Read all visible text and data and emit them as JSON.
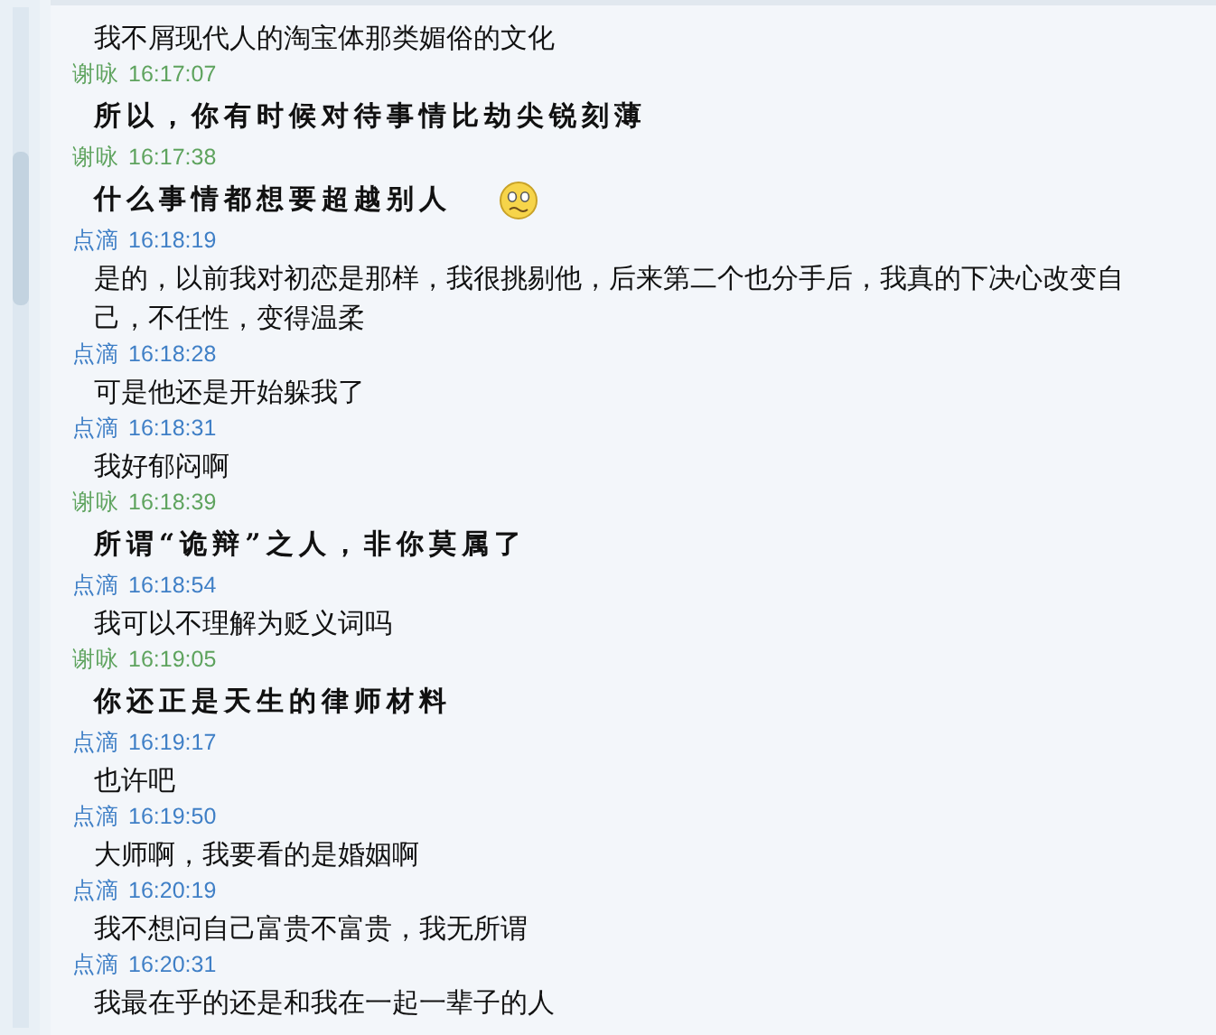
{
  "messages": [
    {
      "text": "我不屑现代人的淘宝体那类媚俗的文化",
      "kind": "plain"
    },
    {
      "sender": "谢咏",
      "time": "16:17:07",
      "color": "#5ea35e",
      "text": "所以，你有时候对待事情比劫尖锐刻薄",
      "kind": "calligraphy"
    },
    {
      "sender": "谢咏",
      "time": "16:17:38",
      "color": "#5ea35e",
      "text": "什么事情都想要超越别人",
      "kind": "calligraphy",
      "emoji": true
    },
    {
      "sender": "点滴",
      "time": "16:18:19",
      "color": "#3f7fc6",
      "text": "是的，以前我对初恋是那样，我很挑剔他，后来第二个也分手后，我真的下决心改变自己，不任性，变得温柔",
      "kind": "plain"
    },
    {
      "sender": "点滴",
      "time": "16:18:28",
      "color": "#3f7fc6",
      "text": "可是他还是开始躲我了",
      "kind": "plain"
    },
    {
      "sender": "点滴",
      "time": "16:18:31",
      "color": "#3f7fc6",
      "text": "我好郁闷啊",
      "kind": "plain"
    },
    {
      "sender": "谢咏",
      "time": "16:18:39",
      "color": "#5ea35e",
      "text": "所谓“诡辩”之人，非你莫属了",
      "kind": "calligraphy"
    },
    {
      "sender": "点滴",
      "time": "16:18:54",
      "color": "#3f7fc6",
      "text": "我可以不理解为贬义词吗",
      "kind": "plain"
    },
    {
      "sender": "谢咏",
      "time": "16:19:05",
      "color": "#5ea35e",
      "text": "你还正是天生的律师材料",
      "kind": "calligraphy"
    },
    {
      "sender": "点滴",
      "time": "16:19:17",
      "color": "#3f7fc6",
      "text": "也许吧",
      "kind": "plain"
    },
    {
      "sender": "点滴",
      "time": "16:19:50",
      "color": "#3f7fc6",
      "text": "大师啊，我要看的是婚姻啊",
      "kind": "plain"
    },
    {
      "sender": "点滴",
      "time": "16:20:19",
      "color": "#3f7fc6",
      "text": "我不想问自己富贵不富贵，我无所谓",
      "kind": "plain"
    },
    {
      "sender": "点滴",
      "time": "16:20:31",
      "color": "#3f7fc6",
      "text": "我最在乎的还是和我在一起一辈子的人",
      "kind": "plain"
    }
  ]
}
